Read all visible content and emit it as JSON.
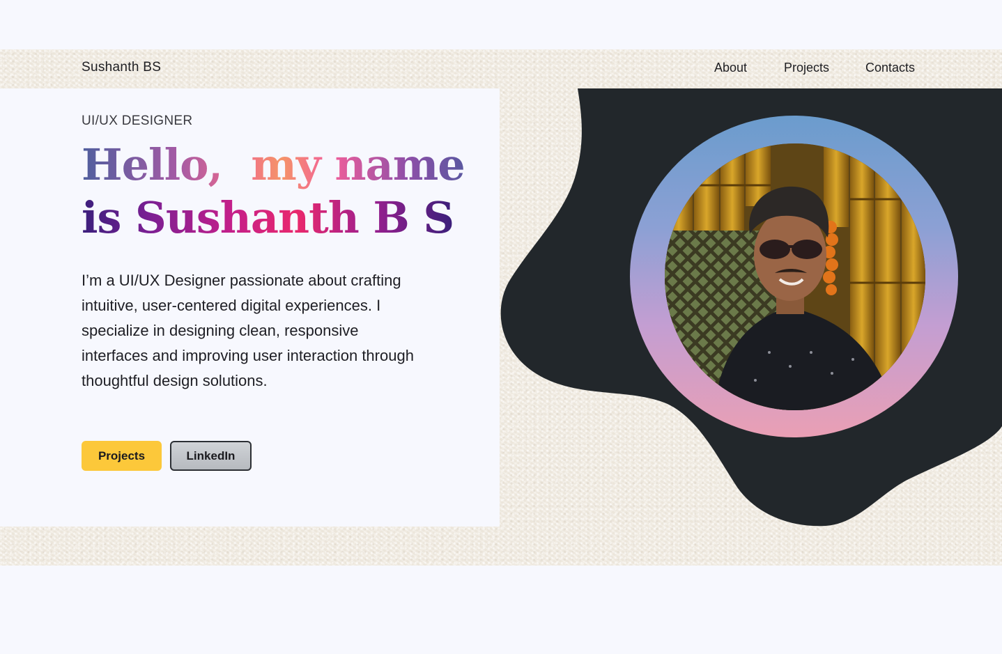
{
  "header": {
    "brand": "Sushanth BS",
    "nav": [
      {
        "label": "About"
      },
      {
        "label": "Projects"
      },
      {
        "label": "Contacts"
      }
    ]
  },
  "hero": {
    "role": "UI/UX DESIGNER",
    "headline_line1": "Hello,  my name",
    "headline_line2": "is Sushanth B S",
    "bio": "I’m a UI/UX Designer passionate about crafting intuitive, user-centered digital experiences. I specialize in designing clean, responsive interfaces and improving user interaction through thoughtful design solutions.",
    "buttons": {
      "projects_label": "Projects",
      "linkedin_label": "LinkedIn"
    }
  },
  "colors": {
    "page_background": "#f7f8fe",
    "paper_band": "#f2ede4",
    "blob": "#22272b",
    "primary_button": "#fcc83a",
    "secondary_button": "#c4c7cb",
    "ring_top": "#6b9ccd",
    "ring_bottom": "#ea9fb4"
  },
  "icons": {
    "portrait": "profile-photo"
  }
}
